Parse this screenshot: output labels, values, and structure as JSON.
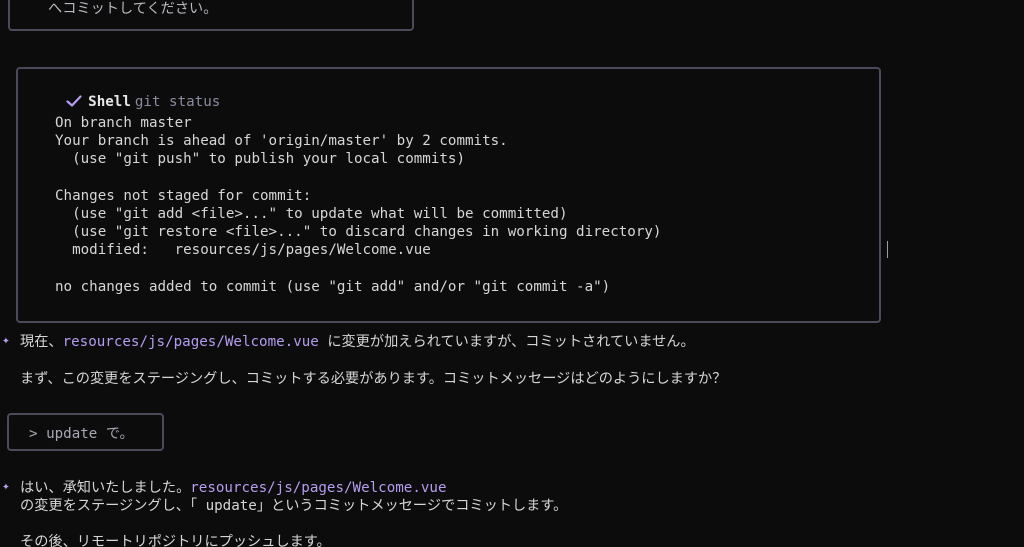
{
  "top_box": {
    "text": "へコミットしてください。"
  },
  "shell": {
    "label": "Shell",
    "command": "git status",
    "output": "On branch master\nYour branch is ahead of 'origin/master' by 2 commits.\n  (use \"git push\" to publish your local commits)\n\nChanges not staged for commit:\n  (use \"git add <file>...\" to update what will be committed)\n  (use \"git restore <file>...\" to discard changes in working directory)\n  modified:   resources/js/pages/Welcome.vue\n\nno changes added to commit (use \"git add\" and/or \"git commit -a\")"
  },
  "assistant_1": {
    "prefix": "現在、",
    "path": "resources/js/pages/Welcome.vue",
    "suffix": " に変更が加えられていますが、コミットされていません。",
    "line2": "まず、この変更をステージングし、コミットする必要があります。コミットメッセージはどのようにしますか？"
  },
  "user_input": {
    "text": "> update で。"
  },
  "assistant_2": {
    "prefix": "はい、承知いたしました。",
    "path": "resources/js/pages/Welcome.vue",
    "line2": "の変更をステージングし、「 update」というコミットメッセージでコミットします。",
    "line3": "その後、リモートリポジトリにプッシュします。"
  },
  "colors": {
    "accent": "#b59cf0",
    "border": "#4a4a5c",
    "background": "#0c0c0c"
  }
}
